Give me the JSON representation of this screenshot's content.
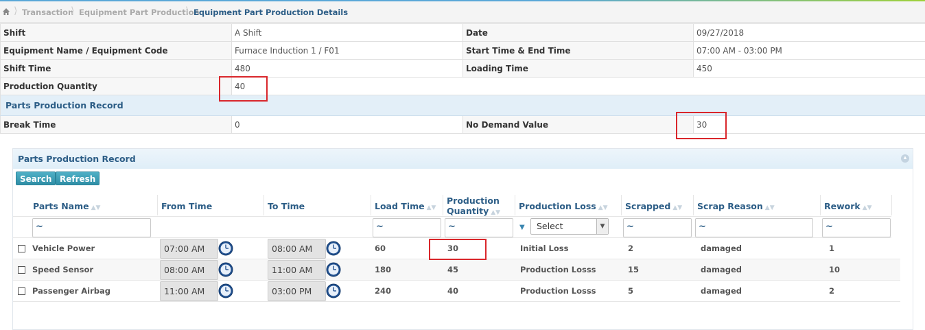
{
  "breadcrumb": {
    "home_icon": "home-icon",
    "items": [
      "Transaction",
      "Equipment Part Production",
      "Equipment Part Production Details"
    ]
  },
  "info": {
    "shift_label": "Shift",
    "shift_value": "A Shift",
    "date_label": "Date",
    "date_value": "09/27/2018",
    "equipment_label": "Equipment Name / Equipment Code",
    "equipment_value": "Furnace Induction 1 / F01",
    "start_end_label": "Start Time & End Time",
    "start_end_value": "07:00 AM - 03:00 PM",
    "shift_time_label": "Shift Time",
    "shift_time_value": "480",
    "loading_time_label": "Loading Time",
    "loading_time_value": "450",
    "production_quantity_label": "Production Quantity",
    "production_quantity_value": "40",
    "section_title": "Parts Production Record",
    "break_time_label": "Break Time",
    "break_time_value": "0",
    "no_demand_label": "No Demand Value",
    "no_demand_value": "30"
  },
  "panel": {
    "title": "Parts Production Record",
    "search_label": "Search",
    "refresh_label": "Refresh"
  },
  "grid": {
    "columns": [
      "Parts Name",
      "From Time",
      "To Time",
      "Load Time",
      "Production Quantity",
      "Production Loss",
      "Scrapped",
      "Scrap Reason",
      "Rework"
    ],
    "filter_symbol": "~",
    "select_placeholder": "Select",
    "rows": [
      {
        "part": "Vehicle Power",
        "from": "07:00 AM",
        "to": "08:00 AM",
        "load": "60",
        "qty": "30",
        "loss": "Initial Loss",
        "scrapped": "2",
        "reason": "damaged",
        "rework": "1"
      },
      {
        "part": "Speed Sensor",
        "from": "08:00 AM",
        "to": "11:00 AM",
        "load": "180",
        "qty": "45",
        "loss": "Production Losss",
        "scrapped": "15",
        "reason": "damaged",
        "rework": "10"
      },
      {
        "part": "Passenger Airbag",
        "from": "11:00 AM",
        "to": "03:00 PM",
        "load": "240",
        "qty": "40",
        "loss": "Production Losss",
        "scrapped": "5",
        "reason": "damaged",
        "rework": "2"
      }
    ]
  },
  "colors": {
    "header_blue": "#2c5d86",
    "button_teal": "#3a9db5",
    "highlight_red": "#d9262b"
  }
}
